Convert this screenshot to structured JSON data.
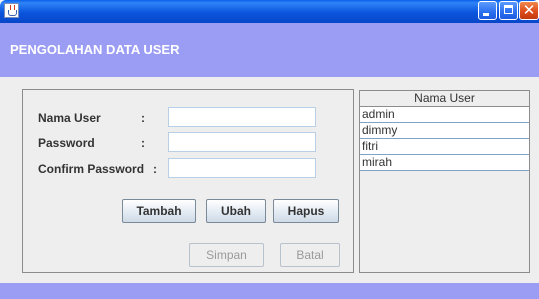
{
  "window": {
    "icon": "java-cup-icon",
    "buttons": {
      "minimize_icon": "minimize-icon",
      "maximize_icon": "maximize-icon",
      "close_icon": "close-icon",
      "close_glyph": "✕"
    }
  },
  "header": {
    "title": "PENGOLAHAN DATA USER"
  },
  "form": {
    "fields": [
      {
        "label": "Nama User",
        "colon": ":",
        "value": ""
      },
      {
        "label": "Password",
        "colon": ":",
        "value": ""
      },
      {
        "label": "Confirm Password",
        "colon": ":",
        "value": ""
      }
    ],
    "buttons": {
      "tambah": "Tambah",
      "ubah": "Ubah",
      "hapus": "Hapus",
      "simpan": "Simpan",
      "batal": "Batal"
    }
  },
  "user_table": {
    "header": "Nama User",
    "rows": [
      "admin",
      "dimmy",
      "fitri",
      "mirah"
    ]
  },
  "colors": {
    "header_band": "#9b9df4",
    "titlebar": "#0b55de",
    "panel_bg": "#eeeeee"
  }
}
